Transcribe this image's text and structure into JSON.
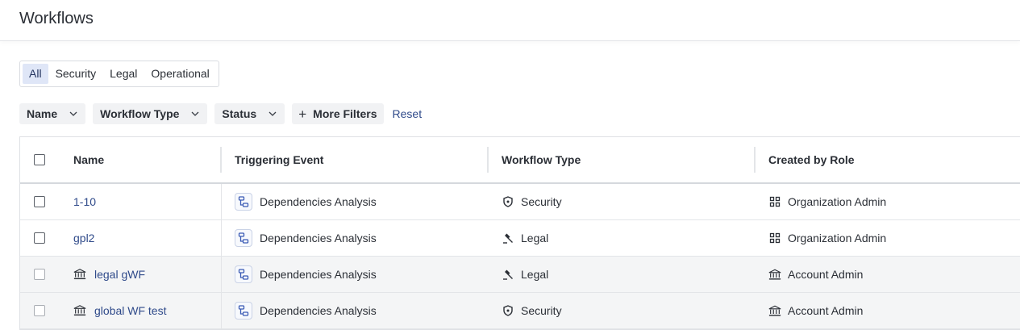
{
  "header": {
    "title": "Workflows"
  },
  "segments": [
    "All",
    "Security",
    "Legal",
    "Operational"
  ],
  "filters": {
    "name": "Name",
    "workflow_type": "Workflow Type",
    "status": "Status",
    "more": "More Filters",
    "reset": "Reset"
  },
  "table": {
    "columns": {
      "name": "Name",
      "trigger": "Triggering Event",
      "type": "Workflow Type",
      "role": "Created by Role"
    },
    "rows": [
      {
        "name": "1-10",
        "trigger": "Dependencies Analysis",
        "type": "Security",
        "role": "Organization Admin"
      },
      {
        "name": "gpl2",
        "trigger": "Dependencies Analysis",
        "type": "Legal",
        "role": "Organization Admin"
      },
      {
        "name": "legal gWF",
        "trigger": "Dependencies Analysis",
        "type": "Legal",
        "role": "Account Admin"
      },
      {
        "name": "global WF test",
        "trigger": "Dependencies Analysis",
        "type": "Security",
        "role": "Account Admin"
      }
    ]
  },
  "colors": {
    "accent": "#2f4a8a",
    "active_segment": "#dfe6f7"
  }
}
